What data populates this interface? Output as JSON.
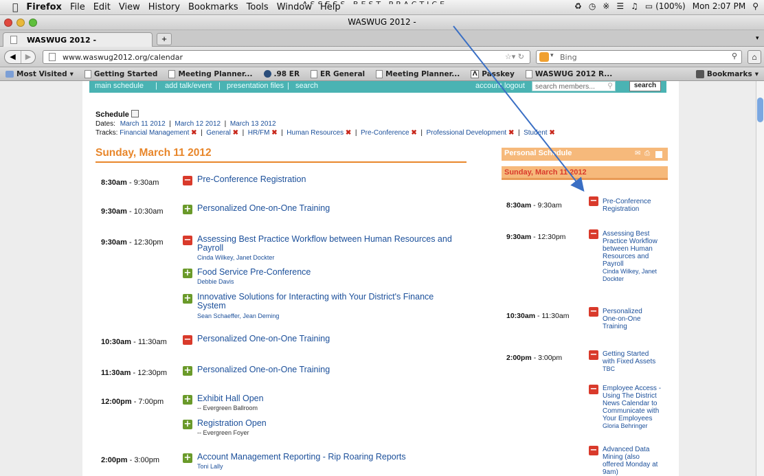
{
  "callout": "ASSESS BEST PRACTICE",
  "menubar": {
    "app": "Firefox",
    "items": [
      "File",
      "Edit",
      "View",
      "History",
      "Bookmarks",
      "Tools",
      "Window",
      "Help"
    ],
    "battery": "(100%)",
    "clock": "Mon 2:07 PM"
  },
  "window": {
    "title": "WASWUG 2012 -"
  },
  "tab": {
    "label": "WASWUG 2012 -",
    "new_tab": "+"
  },
  "nav": {
    "url": "www.waswug2012.org/calendar",
    "search_placeholder": "Bing"
  },
  "bookmarks": {
    "items": [
      "Most Visited",
      "Getting Started",
      "Meeting Planner...",
      ".98 ER",
      "ER General",
      "Meeting Planner...",
      "Passkey",
      "WASWUG 2012 R..."
    ],
    "right": "Bookmarks"
  },
  "sitenav": {
    "main": "main schedule",
    "add": "add talk/event",
    "files": "presentation files",
    "search": "search",
    "account": "account",
    "logout": "logout",
    "search_members": "search members...",
    "search_button": "search"
  },
  "schedule": {
    "heading": "Schedule",
    "dates_label": "Dates:",
    "dates": [
      "March 11 2012",
      "March 12 2012",
      "March 13 2012"
    ],
    "tracks_label": "Tracks:",
    "tracks": [
      "Financial Management",
      "General",
      "HR/FM",
      "Human Resources",
      "Pre-Conference",
      "Professional Development",
      "Student"
    ]
  },
  "day": {
    "title": "Sunday, March 11 2012"
  },
  "slots": [
    {
      "start": "8:30am",
      "end": "- 9:30am",
      "events": [
        {
          "icon": "minus",
          "title": "Pre-Conference Registration"
        }
      ]
    },
    {
      "start": "9:30am",
      "end": "- 10:30am",
      "events": [
        {
          "icon": "plus",
          "title": "Personalized One-on-One Training"
        }
      ]
    },
    {
      "start": "9:30am",
      "end": "- 12:30pm",
      "events": [
        {
          "icon": "minus",
          "title": "Assessing Best Practice Workflow between Human Resources and",
          "title2": "Payroll",
          "people": "Cinda Wilkey, Janet Dockter"
        },
        {
          "icon": "plus",
          "title": "Food Service Pre-Conference",
          "people": "Debbie Davis"
        },
        {
          "icon": "plus",
          "title": "Innovative Solutions for Interacting with Your District's Finance",
          "title2": "System",
          "people": "Sean Schaeffer, Jean Deming"
        }
      ]
    },
    {
      "start": "10:30am",
      "end": "- 11:30am",
      "events": [
        {
          "icon": "minus",
          "title": "Personalized One-on-One Training"
        }
      ]
    },
    {
      "start": "11:30am",
      "end": "- 12:30pm",
      "events": [
        {
          "icon": "plus",
          "title": "Personalized One-on-One Training"
        }
      ]
    },
    {
      "start": "12:00pm",
      "end": "- 7:00pm",
      "events": [
        {
          "icon": "plus",
          "title": "Exhibit Hall Open",
          "location": "-- Evergreen Ballroom"
        },
        {
          "icon": "plus",
          "title": "Registration Open",
          "location": "-- Evergreen Foyer"
        }
      ]
    },
    {
      "start": "2:00pm",
      "end": "- 3:00pm",
      "events": [
        {
          "icon": "plus",
          "title": "Account Management Reporting - Rip Roaring Reports",
          "people": "Toni Lally"
        }
      ]
    }
  ],
  "personal": {
    "header": "Personal Schedule",
    "day": "Sunday, March 11 2012",
    "items": [
      {
        "start": "8:30am",
        "end": "- 9:30am",
        "lines": [
          "Pre-Conference",
          "Registration"
        ]
      },
      {
        "start": "9:30am",
        "end": "- 12:30pm",
        "lines": [
          "Assessing Best",
          "Practice Workflow",
          "between Human",
          "Resources and",
          "Payroll"
        ],
        "people": [
          "Cinda Wilkey, Janet",
          "Dockter"
        ]
      },
      {
        "start": "10:30am",
        "end": "- 11:30am",
        "lines": [
          "Personalized",
          "One-on-One",
          "Training"
        ]
      },
      {
        "start": "2:00pm",
        "end": "- 3:00pm",
        "lines": [
          "Getting Started",
          "with Fixed Assets"
        ],
        "people": [
          "TBC"
        ]
      },
      {
        "lines": [
          "Employee Access -",
          "Using The District",
          "News Calendar to",
          "Communicate with",
          "Your Employees"
        ],
        "people": [
          "Gloria Behringer"
        ]
      },
      {
        "lines": [
          "Advanced Data",
          "Mining (also",
          "offered Monday at",
          "9am)"
        ]
      }
    ]
  }
}
